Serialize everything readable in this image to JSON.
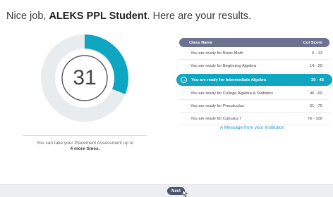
{
  "header": {
    "prefix": "Nice job, ",
    "student_name": "ALEKS PPL Student",
    "suffix": ". Here are your results."
  },
  "score": {
    "value": "31",
    "fraction_of_ring": 0.31,
    "accent_color": "#0fa6c1",
    "ring_color": "#e9ecef"
  },
  "attempts": {
    "line1": "You can take your Placement Assessment up to",
    "line2": "4 more times."
  },
  "table": {
    "col_class": "Class Name",
    "col_cut": "Cut Score",
    "header_color": "#6b7390",
    "rows": [
      {
        "label": "You are ready for Basic Math",
        "cut": "0 - 13"
      },
      {
        "label": "You are ready for Beginning Algebra",
        "cut": "14 - 29"
      },
      {
        "label": "You are ready for Intermediate Algebra",
        "cut": "30 - 45",
        "active": true
      },
      {
        "label": "You are ready for College Algebra & Statistics",
        "cut": "46 - 60"
      },
      {
        "label": "You are ready for Precalculus",
        "cut": "61 - 75"
      },
      {
        "label": "You are ready for Calculus I",
        "cut": "76 - 100"
      }
    ]
  },
  "message_link": "A Message from your Institution",
  "footer": {
    "next_label": "Next"
  }
}
